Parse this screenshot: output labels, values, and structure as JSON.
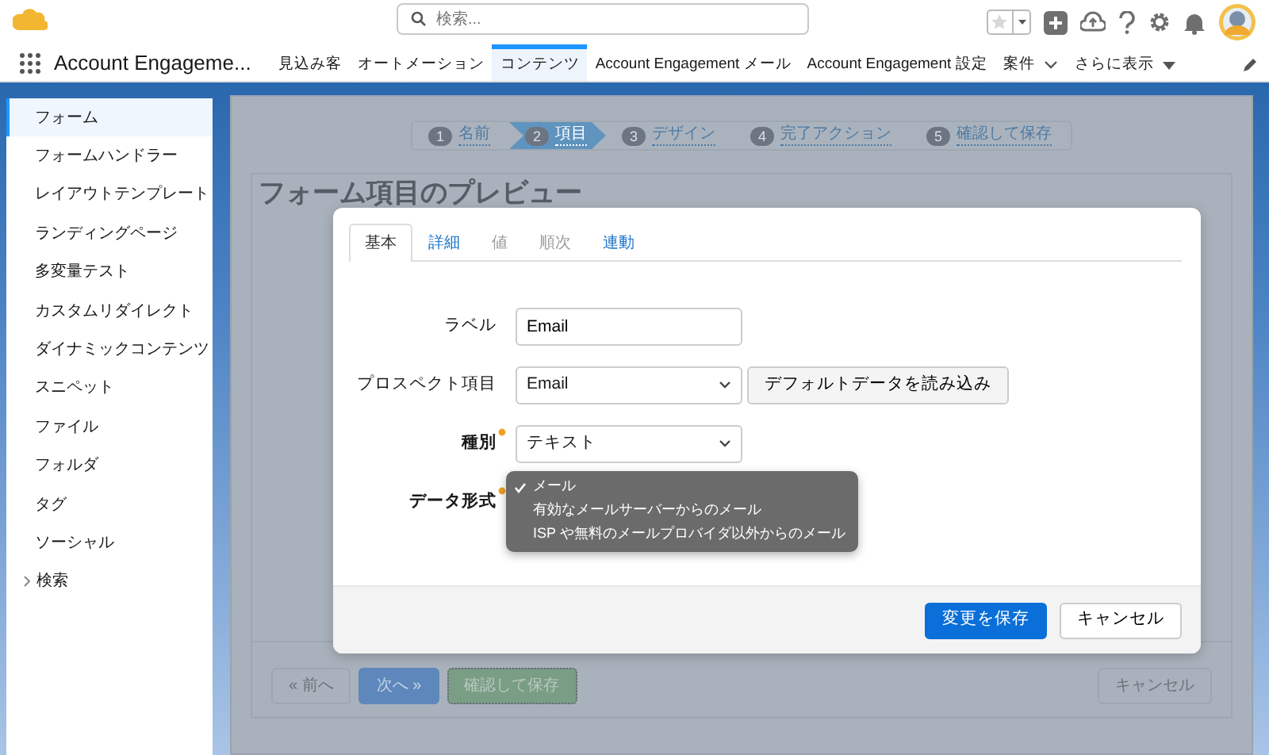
{
  "header": {
    "search_placeholder": "検索..."
  },
  "app_name": "Account Engageme...",
  "nav_tabs": [
    {
      "label": "見込み客",
      "selected": false,
      "kind": "plain"
    },
    {
      "label": "オートメーション",
      "selected": false,
      "kind": "plain"
    },
    {
      "label": "コンテンツ",
      "selected": true,
      "kind": "plain"
    },
    {
      "label": "Account Engagement メール",
      "selected": false,
      "kind": "plain"
    },
    {
      "label": "Account Engagement 設定",
      "selected": false,
      "kind": "plain"
    },
    {
      "label": "案件",
      "selected": false,
      "kind": "chevron"
    },
    {
      "label": "さらに表示",
      "selected": false,
      "kind": "more"
    }
  ],
  "sidebar": {
    "items": [
      {
        "label": "フォーム",
        "selected": true
      },
      {
        "label": "フォームハンドラー",
        "selected": false
      },
      {
        "label": "レイアウトテンプレート",
        "selected": false
      },
      {
        "label": "ランディングページ",
        "selected": false
      },
      {
        "label": "多変量テスト",
        "selected": false
      },
      {
        "label": "カスタムリダイレクト",
        "selected": false
      },
      {
        "label": "ダイナミックコンテンツ",
        "selected": false
      },
      {
        "label": "スニペット",
        "selected": false
      },
      {
        "label": "ファイル",
        "selected": false
      },
      {
        "label": "フォルダ",
        "selected": false
      },
      {
        "label": "タグ",
        "selected": false
      },
      {
        "label": "ソーシャル",
        "selected": false
      }
    ],
    "group": {
      "label": "検索",
      "expanded": false
    }
  },
  "wizard": {
    "steps": [
      {
        "number": "1",
        "label": "名前",
        "selected": false
      },
      {
        "number": "2",
        "label": "項目",
        "selected": true
      },
      {
        "number": "3",
        "label": "デザイン",
        "selected": false
      },
      {
        "number": "4",
        "label": "完了アクション",
        "selected": false
      },
      {
        "number": "5",
        "label": "確認して保存",
        "selected": false
      }
    ]
  },
  "preview_title": "フォーム項目のプレビュー",
  "wizard_buttons": [
    {
      "label": "« 前へ",
      "kind": "default"
    },
    {
      "label": "次へ »",
      "kind": "primary"
    },
    {
      "label": "確認して保存",
      "kind": "success"
    },
    {
      "label": "キャンセル",
      "kind": "default"
    }
  ],
  "modal": {
    "tabs": [
      {
        "label": "基本",
        "selected": true,
        "disabled": false
      },
      {
        "label": "詳細",
        "selected": false,
        "disabled": false
      },
      {
        "label": "値",
        "selected": false,
        "disabled": true
      },
      {
        "label": "順次",
        "selected": false,
        "disabled": true
      },
      {
        "label": "連動",
        "selected": false,
        "disabled": false
      }
    ],
    "fields": [
      {
        "label": "ラベル",
        "required": false,
        "kind": "text",
        "value": "Email"
      },
      {
        "label": "プロスペクト項目",
        "required": false,
        "kind": "select",
        "value": "Email",
        "button": "デフォルトデータを読み込み"
      },
      {
        "label": "種別",
        "required": true,
        "kind": "select",
        "value": "テキスト"
      },
      {
        "label": "データ形式",
        "required": true,
        "kind": "menu",
        "options": [
          {
            "label": "メール",
            "selected": true
          },
          {
            "label": "有効なメールサーバーからのメール",
            "selected": false
          },
          {
            "label": "ISP や無料のメールプロバイダ以外からのメール",
            "selected": false
          }
        ]
      }
    ],
    "footer_buttons": [
      {
        "label": "変更を保存",
        "kind": "primary"
      },
      {
        "label": "キャンセル",
        "kind": "default"
      }
    ]
  }
}
